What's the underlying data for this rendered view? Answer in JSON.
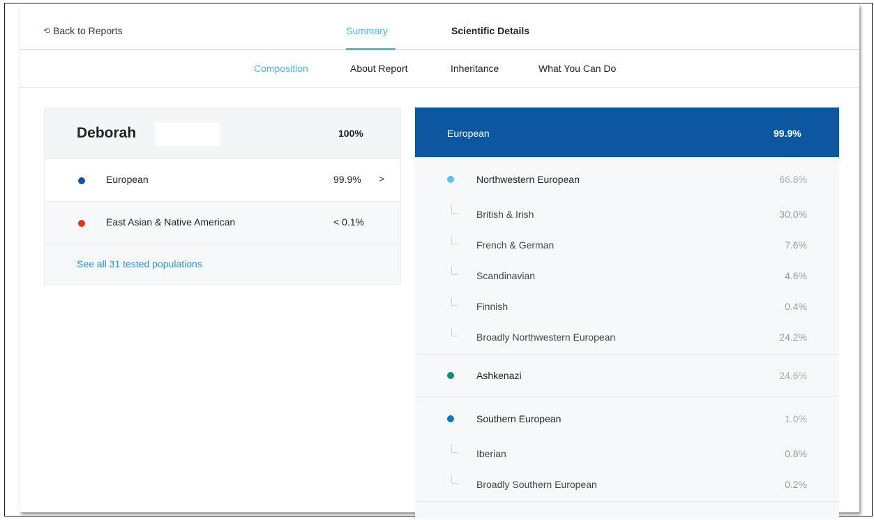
{
  "nav": {
    "back_label": "Back to Reports",
    "back_icon": "undo-arrow-icon",
    "tabs": [
      {
        "label": "Summary",
        "active": true
      },
      {
        "label": "Scientific Details",
        "active": false
      }
    ]
  },
  "subnav": {
    "tabs": [
      {
        "label": "Composition",
        "active": true
      },
      {
        "label": "About Report",
        "active": false
      },
      {
        "label": "Inheritance",
        "active": false
      },
      {
        "label": "What You Can Do",
        "active": false
      }
    ]
  },
  "summary": {
    "name": "Deborah",
    "total": "100%",
    "rows": [
      {
        "label": "European",
        "pct": "99.9%",
        "color": "#1057a3",
        "chevron": ">"
      },
      {
        "label": "East Asian & Native American",
        "pct": "< 0.1%",
        "color": "#d9381e"
      }
    ],
    "link": "See all 31 tested populations"
  },
  "detail": {
    "header_label": "European",
    "header_pct": "99.9%",
    "header_color": "#0d56a0",
    "groups": [
      {
        "label": "Northwestern European",
        "pct": "66.8%",
        "color": "#5ec4ef",
        "subs": [
          {
            "label": "British & Irish",
            "pct": "30.0%"
          },
          {
            "label": "French & German",
            "pct": "7.6%"
          },
          {
            "label": "Scandinavian",
            "pct": "4.6%"
          },
          {
            "label": "Finnish",
            "pct": "0.4%"
          },
          {
            "label": "Broadly Northwestern European",
            "pct": "24.2%"
          }
        ]
      },
      {
        "label": "Ashkenazi",
        "pct": "24.6%",
        "color": "#128a7c",
        "subs": []
      },
      {
        "label": "Southern European",
        "pct": "1.0%",
        "color": "#0a7ab8",
        "subs": [
          {
            "label": "Iberian",
            "pct": "0.8%"
          },
          {
            "label": "Broadly Southern European",
            "pct": "0.2%"
          }
        ]
      }
    ]
  }
}
